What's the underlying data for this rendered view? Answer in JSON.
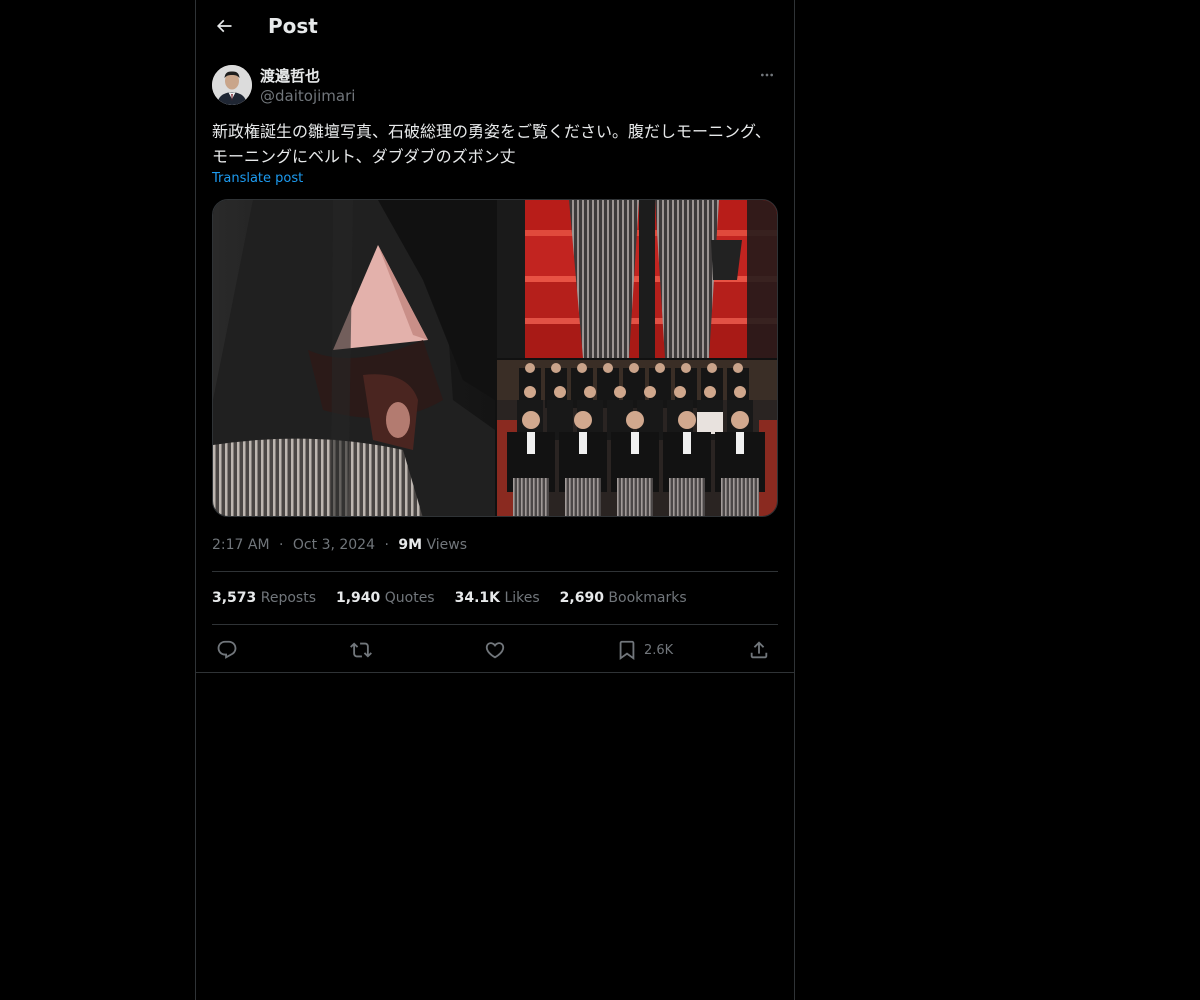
{
  "header": {
    "title": "Post",
    "back_icon": "arrow-left-icon"
  },
  "post": {
    "author": {
      "display_name": "渡邉哲也",
      "handle": "@daitojimari",
      "avatar": "avatar-photo"
    },
    "text": "新政権誕生の雛壇写真、石破総理の勇姿をご覧ください。腹だしモーニング、モーニングにベルト、ダブダブのズボン丈",
    "translate_label": "Translate post",
    "timestamp": {
      "time": "2:17 AM",
      "separator": "·",
      "date": "Oct 3, 2024",
      "separator2": "·",
      "views_count": "9M",
      "views_label": "Views"
    },
    "stats": [
      {
        "count": "3,573",
        "label": "Reposts"
      },
      {
        "count": "1,940",
        "label": "Quotes"
      },
      {
        "count": "34.1K",
        "label": "Likes"
      },
      {
        "count": "2,690",
        "label": "Bookmarks"
      }
    ],
    "actions": {
      "reply_icon": "reply-icon",
      "repost_icon": "repost-icon",
      "like_icon": "heart-icon",
      "bookmark_icon": "bookmark-icon",
      "bookmark_count": "2.6K",
      "share_icon": "share-icon"
    }
  },
  "colors": {
    "background": "#000000",
    "border": "#2f3336",
    "text_primary": "#e7e9ea",
    "text_secondary": "#71767b",
    "link": "#1d9bf0"
  }
}
